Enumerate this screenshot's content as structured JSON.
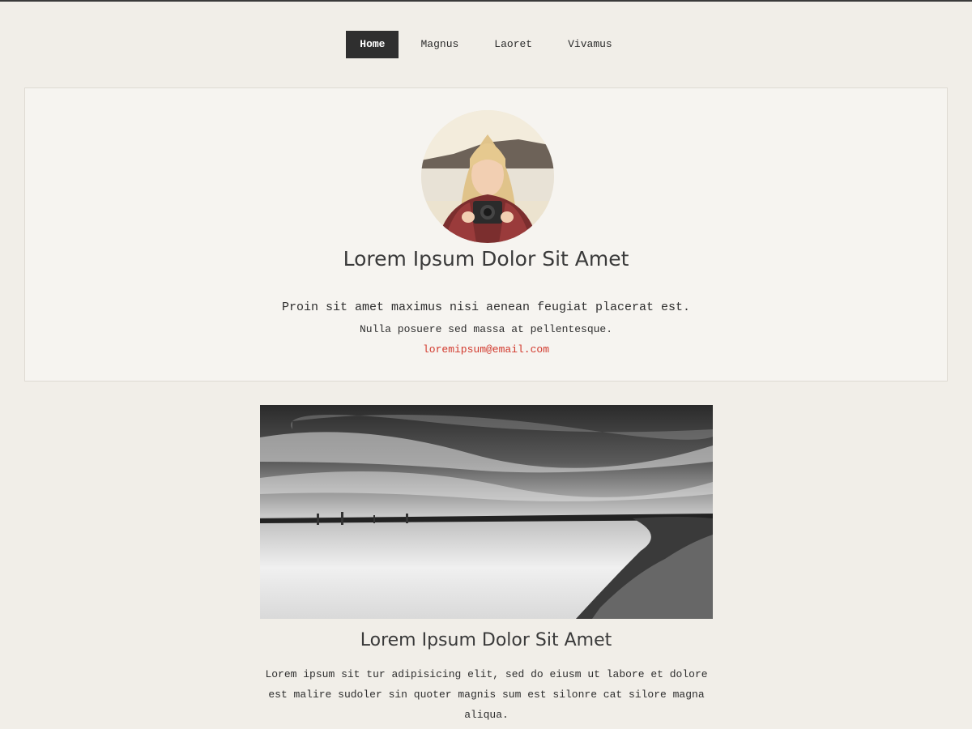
{
  "nav": {
    "items": [
      {
        "label": "Home",
        "active": true
      },
      {
        "label": "Magnus",
        "active": false
      },
      {
        "label": "Laoret",
        "active": false
      },
      {
        "label": "Vivamus",
        "active": false
      }
    ]
  },
  "profile": {
    "title": "Lorem Ipsum Dolor Sit Amet",
    "line1": "Proin sit amet maximus nisi aenean feugiat placerat est.",
    "line2": "Nulla posuere sed massa at pellentesque.",
    "email": "loremipsum@email.com"
  },
  "post": {
    "title": "Lorem Ipsum Dolor Sit Amet",
    "text": "Lorem ipsum sit tur adipisicing elit, sed do eiusm ut labore et dolore est malire sudoler sin quoter magnis sum est silonre cat silore magna aliqua."
  },
  "colors": {
    "accent": "#d23a2e",
    "nav_active_bg": "#2f2f2f",
    "page_bg": "#f1eee8"
  }
}
